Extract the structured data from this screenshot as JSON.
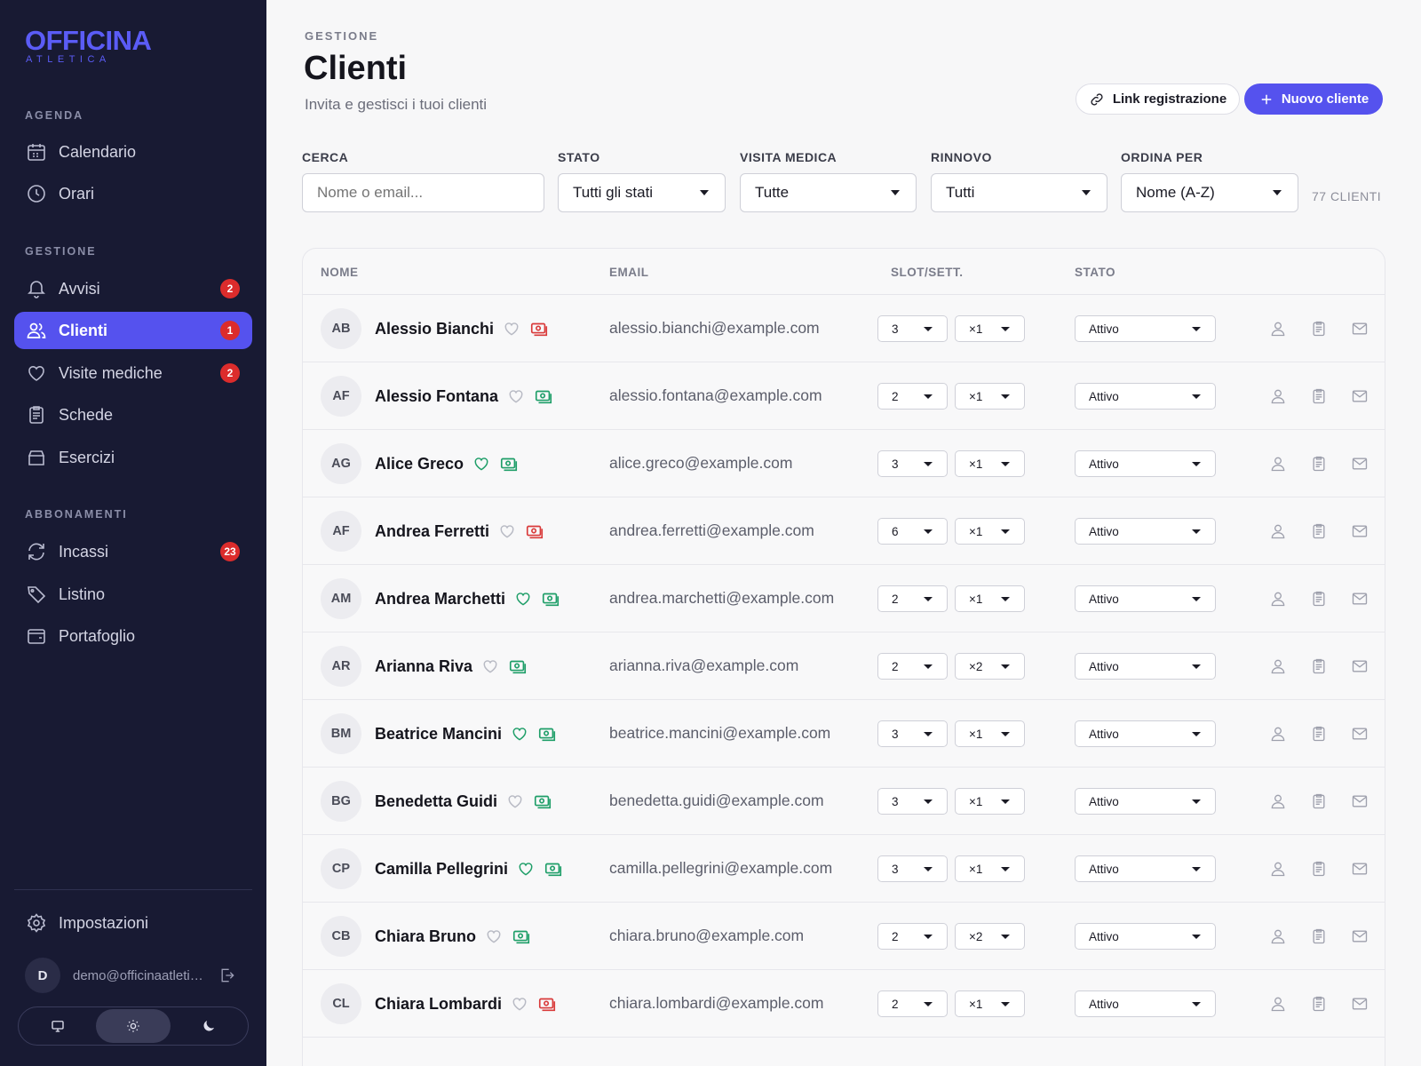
{
  "sidebar": {
    "logo": {
      "main": "OFFICINA",
      "sub": "ATLETICA"
    },
    "sections": [
      {
        "label": "AGENDA",
        "items": [
          {
            "label": "Calendario",
            "icon": "calendar-icon"
          },
          {
            "label": "Orari",
            "icon": "clock-icon"
          }
        ]
      },
      {
        "label": "GESTIONE",
        "items": [
          {
            "label": "Avvisi",
            "icon": "bell-icon",
            "badge": "2"
          },
          {
            "label": "Clienti",
            "icon": "users-icon",
            "badge": "1",
            "active": true
          },
          {
            "label": "Visite mediche",
            "icon": "heart-icon",
            "badge": "2"
          },
          {
            "label": "Schede",
            "icon": "clipboard-icon"
          },
          {
            "label": "Esercizi",
            "icon": "box-icon"
          }
        ]
      },
      {
        "label": "ABBONAMENTI",
        "items": [
          {
            "label": "Incassi",
            "icon": "refresh-icon",
            "badge": "23"
          },
          {
            "label": "Listino",
            "icon": "tag-icon"
          },
          {
            "label": "Portafoglio",
            "icon": "wallet-icon"
          }
        ]
      }
    ],
    "settings_label": "Impostazioni",
    "user": {
      "initial": "D",
      "email": "demo@officinaatletica.it"
    },
    "theme": {
      "options": [
        "system",
        "light",
        "dark"
      ],
      "selected": "light"
    }
  },
  "header": {
    "eyebrow": "GESTIONE",
    "title": "Clienti",
    "subtitle": "Invita e gestisci i tuoi clienti",
    "link_button": "Link registrazione",
    "new_button": "Nuovo cliente"
  },
  "filters": {
    "search": {
      "label": "CERCA",
      "placeholder": "Nome o email..."
    },
    "status": {
      "label": "STATO",
      "value": "Tutti gli stati"
    },
    "medical": {
      "label": "VISITA MEDICA",
      "value": "Tutte"
    },
    "renewal": {
      "label": "RINNOVO",
      "value": "Tutti"
    },
    "sort": {
      "label": "ORDINA PER",
      "value": "Nome (A-Z)"
    },
    "count": "77 CLIENTI"
  },
  "table": {
    "columns": [
      "NOME",
      "EMAIL",
      "SLOT/SETT.",
      "STATO"
    ],
    "rows": [
      {
        "initials": "AB",
        "name": "Alessio Bianchi",
        "email": "alessio.bianchi@example.com",
        "slots": "3",
        "mult": "×1",
        "status": "Attivo",
        "medical_ok": false,
        "payment_ok": false
      },
      {
        "initials": "AF",
        "name": "Alessio Fontana",
        "email": "alessio.fontana@example.com",
        "slots": "2",
        "mult": "×1",
        "status": "Attivo",
        "medical_ok": false,
        "payment_ok": true
      },
      {
        "initials": "AG",
        "name": "Alice Greco",
        "email": "alice.greco@example.com",
        "slots": "3",
        "mult": "×1",
        "status": "Attivo",
        "medical_ok": true,
        "payment_ok": true
      },
      {
        "initials": "AF",
        "name": "Andrea Ferretti",
        "email": "andrea.ferretti@example.com",
        "slots": "6",
        "mult": "×1",
        "status": "Attivo",
        "medical_ok": false,
        "payment_ok": false
      },
      {
        "initials": "AM",
        "name": "Andrea Marchetti",
        "email": "andrea.marchetti@example.com",
        "slots": "2",
        "mult": "×1",
        "status": "Attivo",
        "medical_ok": true,
        "payment_ok": true
      },
      {
        "initials": "AR",
        "name": "Arianna Riva",
        "email": "arianna.riva@example.com",
        "slots": "2",
        "mult": "×2",
        "status": "Attivo",
        "medical_ok": false,
        "payment_ok": true
      },
      {
        "initials": "BM",
        "name": "Beatrice Mancini",
        "email": "beatrice.mancini@example.com",
        "slots": "3",
        "mult": "×1",
        "status": "Attivo",
        "medical_ok": true,
        "payment_ok": true
      },
      {
        "initials": "BG",
        "name": "Benedetta Guidi",
        "email": "benedetta.guidi@example.com",
        "slots": "3",
        "mult": "×1",
        "status": "Attivo",
        "medical_ok": false,
        "payment_ok": true
      },
      {
        "initials": "CP",
        "name": "Camilla Pellegrini",
        "email": "camilla.pellegrini@example.com",
        "slots": "3",
        "mult": "×1",
        "status": "Attivo",
        "medical_ok": true,
        "payment_ok": true
      },
      {
        "initials": "CB",
        "name": "Chiara Bruno",
        "email": "chiara.bruno@example.com",
        "slots": "2",
        "mult": "×2",
        "status": "Attivo",
        "medical_ok": false,
        "payment_ok": true
      },
      {
        "initials": "CL",
        "name": "Chiara Lombardi",
        "email": "chiara.lombardi@example.com",
        "slots": "2",
        "mult": "×1",
        "status": "Attivo",
        "medical_ok": false,
        "payment_ok": false
      }
    ]
  },
  "colors": {
    "accent": "#5552ee",
    "sidebar_bg": "#181a33",
    "badge_red": "#dc2c2c",
    "ok_green": "#1e9e68",
    "alert_red": "#d93a3a",
    "muted_heart": "#b8bac4"
  }
}
